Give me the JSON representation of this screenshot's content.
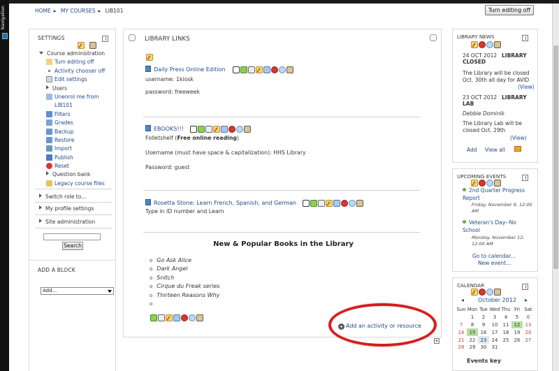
{
  "nav": {
    "label": "Navigation"
  },
  "breadcrumb": [
    "HOME",
    "MY COURSES",
    "LIB101"
  ],
  "header": {
    "turn_editing_off": "Turn editing off"
  },
  "settings": {
    "title": "SETTINGS",
    "items": [
      {
        "label": "Course administration",
        "type": "expanded"
      },
      {
        "label": "Turn editing off",
        "icon": "edit-icon"
      },
      {
        "label": "Activity chooser off",
        "icon": "bullet"
      },
      {
        "label": "Edit settings",
        "icon": "settings-icon"
      },
      {
        "label": "Users",
        "type": "collapsed"
      },
      {
        "label": "Unenrol me from",
        "icon": "user-icon"
      },
      {
        "label": "LIB101",
        "icon": "none"
      },
      {
        "label": "Filters",
        "icon": "filter-icon"
      },
      {
        "label": "Grades",
        "icon": "grades-icon"
      },
      {
        "label": "Backup",
        "icon": "backup-icon"
      },
      {
        "label": "Restore",
        "icon": "restore-icon"
      },
      {
        "label": "Import",
        "icon": "import-icon"
      },
      {
        "label": "Publish",
        "icon": "publish-icon"
      },
      {
        "label": "Reset",
        "icon": "reset-icon"
      },
      {
        "label": "Question bank",
        "type": "collapsed"
      },
      {
        "label": "Legacy course files",
        "icon": "folder-icon"
      }
    ],
    "switch_role": "Switch role to...",
    "my_profile": "My profile settings",
    "site_admin": "Site administration",
    "search_button": "Search"
  },
  "add_block": {
    "title": "ADD A BLOCK",
    "select_value": "Add..."
  },
  "main": {
    "section_title": "LIBRARY LINKS",
    "resources": [
      {
        "title": "Daily Press Online Edition",
        "lines": [
          "username: 1kiosk",
          "password: freeweek"
        ]
      },
      {
        "title": "EBOOKS!!!",
        "lines": [
          "Folletshelf (",
          "Free online reading",
          ")",
          "Username (must have space & capitalization): HHS Library",
          "Password: guest"
        ]
      },
      {
        "title": "Rosetta Stone: Learn French, Spanish, and German",
        "lines": [
          "Type in ID number and Learn"
        ]
      }
    ],
    "books_title": "New & Popular Books in the Library",
    "books": [
      "Go Ask Alice",
      "Dark Angel",
      "Snitch",
      "Cirque du Freak series",
      "Thirteen Reasons Why",
      ""
    ],
    "add_activity": "Add an activity or resource"
  },
  "library_news": {
    "title": "LIBRARY NEWS",
    "items": [
      {
        "date": "24 OCT 2012",
        "heading1": "LIBRARY",
        "heading2": "CLOSED",
        "body1": "The Library will be closed",
        "body2": "Oct. 30th all day for AVID",
        "view": "(View)"
      },
      {
        "date": "23 OCT 2012",
        "heading1": "LIBRARY",
        "heading2": "LAB",
        "author": "Debbie Dominik",
        "body1": "The Library Lab will be",
        "body2": "closed Oct. 29th",
        "view": "(View)"
      }
    ],
    "add": "Add",
    "view_all": "View all"
  },
  "upcoming_events": {
    "title": "UPCOMING EVENTS",
    "events": [
      {
        "title1": "2nd Quarter Progress",
        "title2": "Report",
        "when1": "Friday, November 9, 12:00",
        "when2": "AM"
      },
      {
        "title1": "Veteran's Day--No",
        "title2": "School",
        "when1": "Monday, November 12,",
        "when2": "12:00 AM"
      }
    ],
    "go_calendar": "Go to calendar...",
    "new_event": "New event..."
  },
  "calendar": {
    "title": "CALENDAR",
    "month": "October 2012",
    "weekdays": [
      "Sun",
      "Mon",
      "Tue",
      "Wed",
      "Thu",
      "Fri",
      "Sat"
    ],
    "weeks": [
      [
        "",
        "1",
        "2",
        "3",
        "4",
        "5",
        "6"
      ],
      [
        "7",
        "8",
        "9",
        "10",
        "11",
        "12",
        "13"
      ],
      [
        "14",
        "15",
        "16",
        "17",
        "18",
        "19",
        "20"
      ],
      [
        "21",
        "22",
        "23",
        "24",
        "25",
        "26",
        "27"
      ],
      [
        "28",
        "29",
        "30",
        "31",
        "",
        "",
        ""
      ]
    ],
    "events_key": "Events key"
  },
  "colors": {
    "link": "#1f4a86",
    "highlight_ring": "#d71c1c"
  }
}
